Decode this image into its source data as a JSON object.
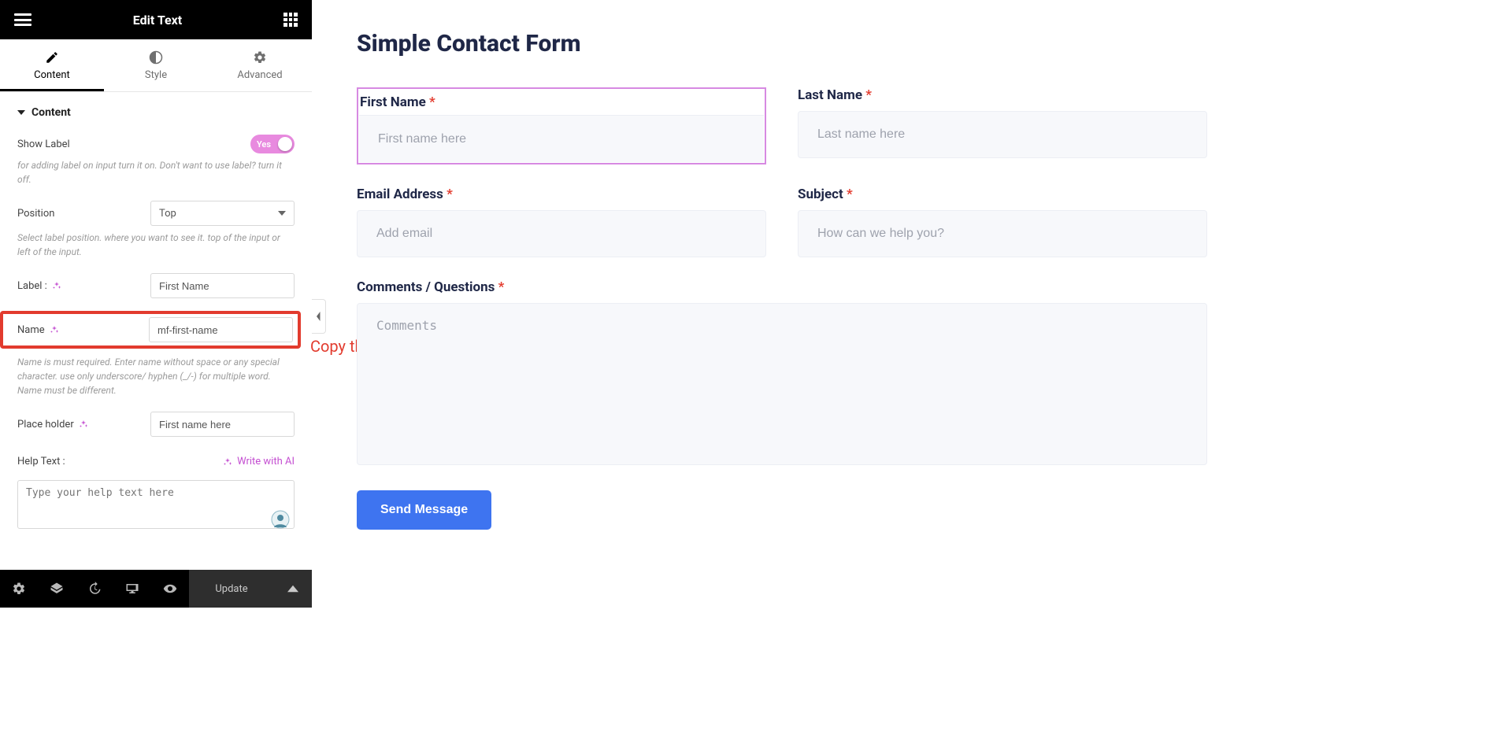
{
  "editor": {
    "title": "Edit Text",
    "tabs": {
      "content": "Content",
      "style": "Style",
      "advanced": "Advanced"
    },
    "section_header": "Content",
    "show_label": {
      "label": "Show Label",
      "value": "Yes",
      "help": "for adding label on input turn it on. Don't want to use label? turn it off."
    },
    "position": {
      "label": "Position",
      "value": "Top",
      "help": "Select label position. where you want to see it. top of the input or left of the input."
    },
    "label_field": {
      "label": "Label :",
      "value": "First Name"
    },
    "name_field": {
      "label": "Name",
      "value": "mf-first-name",
      "help": "Name is must required. Enter name without space or any special character. use only underscore/ hyphen (_/-) for multiple word. Name must be different."
    },
    "placeholder_field": {
      "label": "Place holder",
      "value": "First name here"
    },
    "help_text": {
      "label": "Help Text :",
      "ai": "Write with AI",
      "placeholder": "Type your help text here"
    },
    "footer": {
      "update": "Update"
    }
  },
  "annotation": {
    "copy_name": "Copy the Name"
  },
  "preview": {
    "title": "Simple Contact Form",
    "fields": {
      "first_name": {
        "label": "First Name",
        "placeholder": "First name here",
        "required": true
      },
      "last_name": {
        "label": "Last Name",
        "placeholder": "Last name here",
        "required": true
      },
      "email": {
        "label": "Email Address",
        "placeholder": "Add email",
        "required": true
      },
      "subject": {
        "label": "Subject",
        "placeholder": "How can we help you?",
        "required": true
      },
      "comments": {
        "label": "Comments / Questions",
        "placeholder": "Comments",
        "required": true
      }
    },
    "submit": "Send Message"
  }
}
